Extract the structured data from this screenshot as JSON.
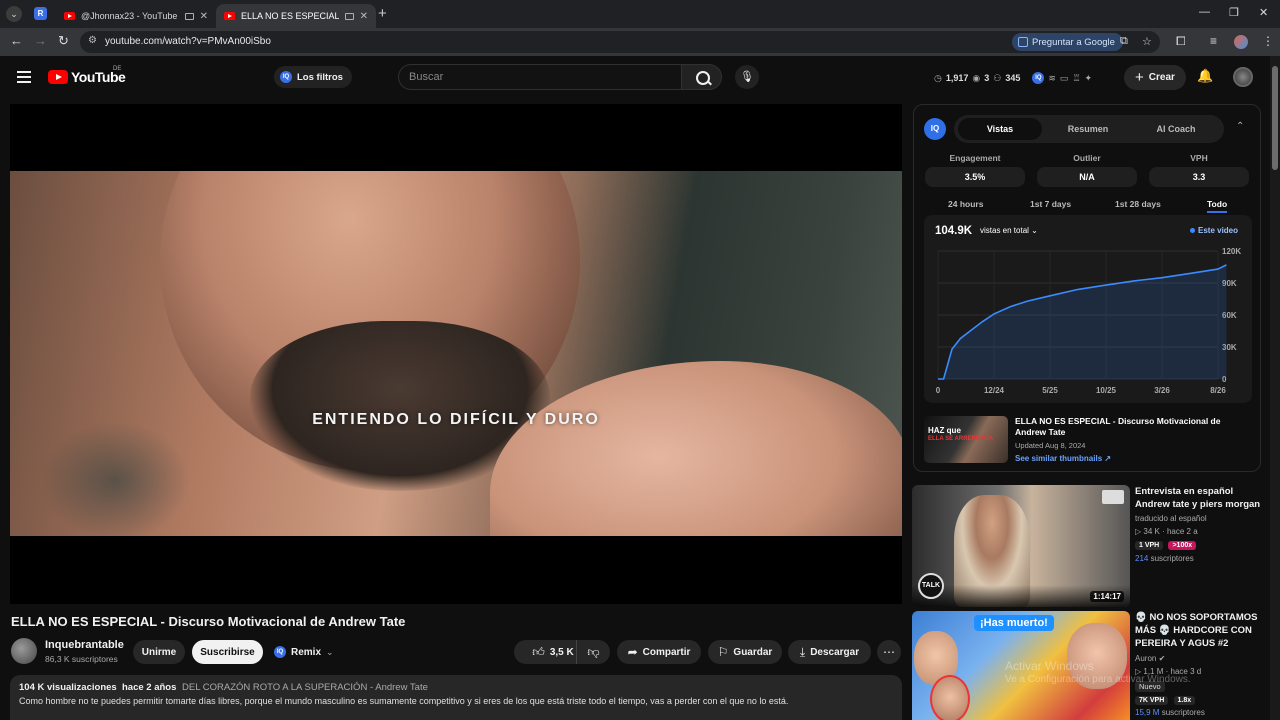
{
  "browser": {
    "profile_badge": "R",
    "tabs": [
      {
        "title": "@Jhonnax23 - YouTube"
      },
      {
        "title": "ELLA NO ES ESPECIAL - Discurso"
      }
    ],
    "url": "youtube.com/watch?v=PMvAn00iSbo",
    "ask_google": "Preguntar a Google"
  },
  "header": {
    "logo_text": "YouTube",
    "country": "DE",
    "filters_label": "Los filtros",
    "search_placeholder": "Buscar",
    "stat1": "1,917",
    "stat2": "3",
    "stat3": "345",
    "create_label": "Crear"
  },
  "player": {
    "subtitle": "ENTIENDO LO DIFÍCIL Y DURO"
  },
  "video": {
    "title": "ELLA NO ES ESPECIAL - Discurso Motivacional de Andrew Tate",
    "channel": "Inquebrantable",
    "subscribers": "86,3 K suscriptores",
    "join": "Unirme",
    "subscribe": "Suscribirse",
    "remix": "Remix",
    "likes": "3,5 K",
    "share": "Compartir",
    "save": "Guardar",
    "download": "Descargar",
    "views": "104 K visualizaciones",
    "age": "hace 2 años",
    "tag": "DEL CORAZÓN ROTO A LA SUPERACIÓN - Andrew Tate",
    "description": "Como hombre no te puedes permitir tomarte días libres, porque el mundo masculino es sumamente competitivo y si eres de los que está triste todo el tiempo, vas a perder con el que no lo está."
  },
  "iq_panel": {
    "logo": "IQ",
    "tabs": [
      "Vistas",
      "Resumen",
      "AI Coach"
    ],
    "active_tab": "Vistas",
    "metrics": [
      {
        "label": "Engagement",
        "value": "3.5%"
      },
      {
        "label": "Outlier",
        "value": "N/A"
      },
      {
        "label": "VPH",
        "value": "3.3"
      }
    ],
    "ranges": [
      "24 hours",
      "1st 7 days",
      "1st 28 days",
      "Todo"
    ],
    "active_range": "Todo",
    "total_views": "104.9K",
    "views_dropdown": "vistas en total",
    "legend": "Este video",
    "rec_thumb_text": "HAZ que",
    "rec_thumb_sub": "ELLA SE ARREPIENTA",
    "rec_title": "ELLA NO ES ESPECIAL - Discurso Motivacional de Andrew Tate",
    "rec_updated": "Updated Aug 8, 2024",
    "rec_link": "See similar thumbnails ↗"
  },
  "chart_data": {
    "type": "line",
    "title": "",
    "x_ticks": [
      "0",
      "12/24",
      "5/25",
      "10/25",
      "3/26",
      "8/26"
    ],
    "y_ticks": [
      "120K",
      "90K",
      "60K",
      "30K",
      "0"
    ],
    "ylim": [
      0,
      120000
    ],
    "series": [
      {
        "name": "Este video",
        "x": [
          0,
          0.1,
          0.25,
          0.4,
          0.6,
          0.8,
          1.0,
          1.3,
          1.6,
          2.0,
          2.5,
          3.0,
          3.5,
          4.0,
          4.5,
          5.0,
          5.15
        ],
        "y": [
          0,
          0,
          28000,
          38000,
          46000,
          54000,
          61000,
          68000,
          73000,
          78000,
          84000,
          88000,
          92000,
          95000,
          99000,
          103000,
          107000
        ]
      }
    ],
    "grid": true,
    "legend_position": "top-right"
  },
  "side": {
    "video1": {
      "title": "Entrevista en español Andrew tate y piers morgan",
      "channel": "traducido al español",
      "views": "34 K",
      "age": "hace 2 a",
      "vph": "1 VPH",
      "outlier": ">100x",
      "subs_num": "214",
      "subs_label": "suscriptores",
      "duration": "1:14:17",
      "talk": "TALK"
    },
    "video2": {
      "title": "💀 NO NOS SOPORTAMOS MÁS 💀 HARDCORE CON PEREIRA Y AGUS #2",
      "channel": "Auron",
      "views": "1,1 M",
      "age": "hace 3 d",
      "new": "Nuevo",
      "vph": "7K VPH",
      "outlier": "1.8x",
      "subs_num": "15,9 M",
      "subs_label": "suscriptores",
      "banner": "¡Has muerto!"
    }
  },
  "watermark": {
    "line1": "Activar Windows",
    "line2": "Ve a Configuración para activar Windows."
  }
}
